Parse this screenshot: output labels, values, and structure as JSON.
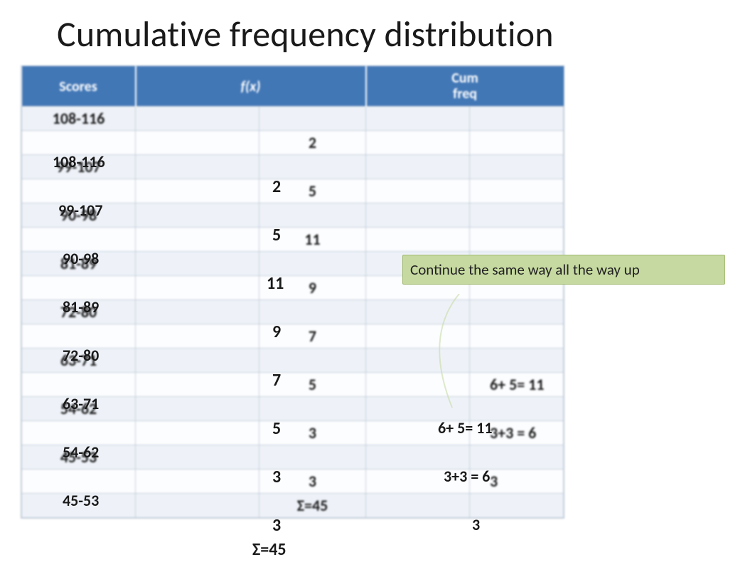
{
  "title": "Cumulative frequency distribution",
  "headers": {
    "scores": "Scores",
    "fx": "f(x)",
    "cum": "Cum\nfreq"
  },
  "rows": [
    {
      "score": "108-116",
      "fx": "2",
      "cum": ""
    },
    {
      "score": "99-107",
      "fx": "5",
      "cum": ""
    },
    {
      "score": "90-98",
      "fx": "11",
      "cum": ""
    },
    {
      "score": "81-89",
      "fx": "9",
      "cum": ""
    },
    {
      "score": "72-80",
      "fx": "7",
      "cum": ""
    },
    {
      "score": "63-71",
      "fx": "5",
      "cum": "6+ 5= 11"
    },
    {
      "score": "54-62",
      "fx": "3",
      "cum": "3+3 = 6"
    },
    {
      "score": "45-53",
      "fx": "3",
      "cum": "3"
    }
  ],
  "sum_label": "Σ=45",
  "callout": "Continue the same way all the way up"
}
